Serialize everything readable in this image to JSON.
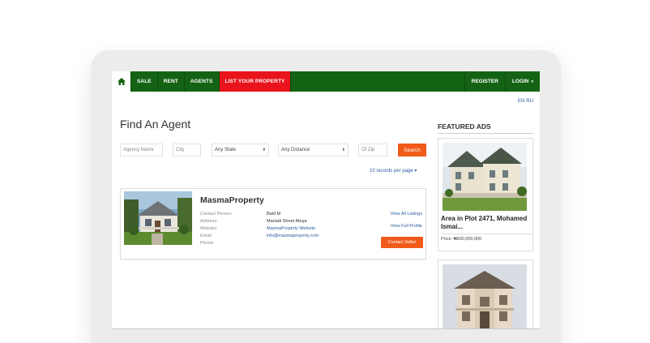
{
  "colors": {
    "nav_green": "#146314",
    "nav_red": "#e8131b",
    "accent_orange": "#f05a1a",
    "link_blue": "#2b5e9e"
  },
  "nav": {
    "home_icon": "home-icon",
    "items": [
      "SALE",
      "RENT",
      "AGENTS"
    ],
    "list_property": "LIST YOUR PROPERTY",
    "register": "REGISTER",
    "login": "LOGIN",
    "login_caret": "▾"
  },
  "lang": {
    "en": "EN",
    "ru": "RU"
  },
  "page": {
    "title": "Find An Agent"
  },
  "search": {
    "agency_placeholder": "Agency Name",
    "city_placeholder": "City",
    "state_value": "Any State",
    "distance_value": "Any Distance",
    "zip_placeholder": "Of Zip",
    "button": "Search",
    "select_arrow": "⬍"
  },
  "results": {
    "per_page": "10 records per page ▾"
  },
  "agent": {
    "name": "MasmaProperty",
    "labels": {
      "contact": "Contact Person:",
      "address": "Address:",
      "website": "Website:",
      "email": "Email:",
      "phone": "Phone:"
    },
    "values": {
      "contact": "Bald M",
      "address": "Mariadi Street Abuja",
      "website": "MasmaProperty Website",
      "email": "info@masmaproperty.com",
      "phone": ""
    },
    "view_listings": "View All Listings",
    "view_profile": "View Full Profile",
    "contact_button": "Contact Seller"
  },
  "featured": {
    "title": "FEATURED ADS",
    "ads": [
      {
        "title": "Area in Plot 2471, Mohamed Ismai...",
        "price": "Price: ₦600,000,000"
      }
    ]
  }
}
